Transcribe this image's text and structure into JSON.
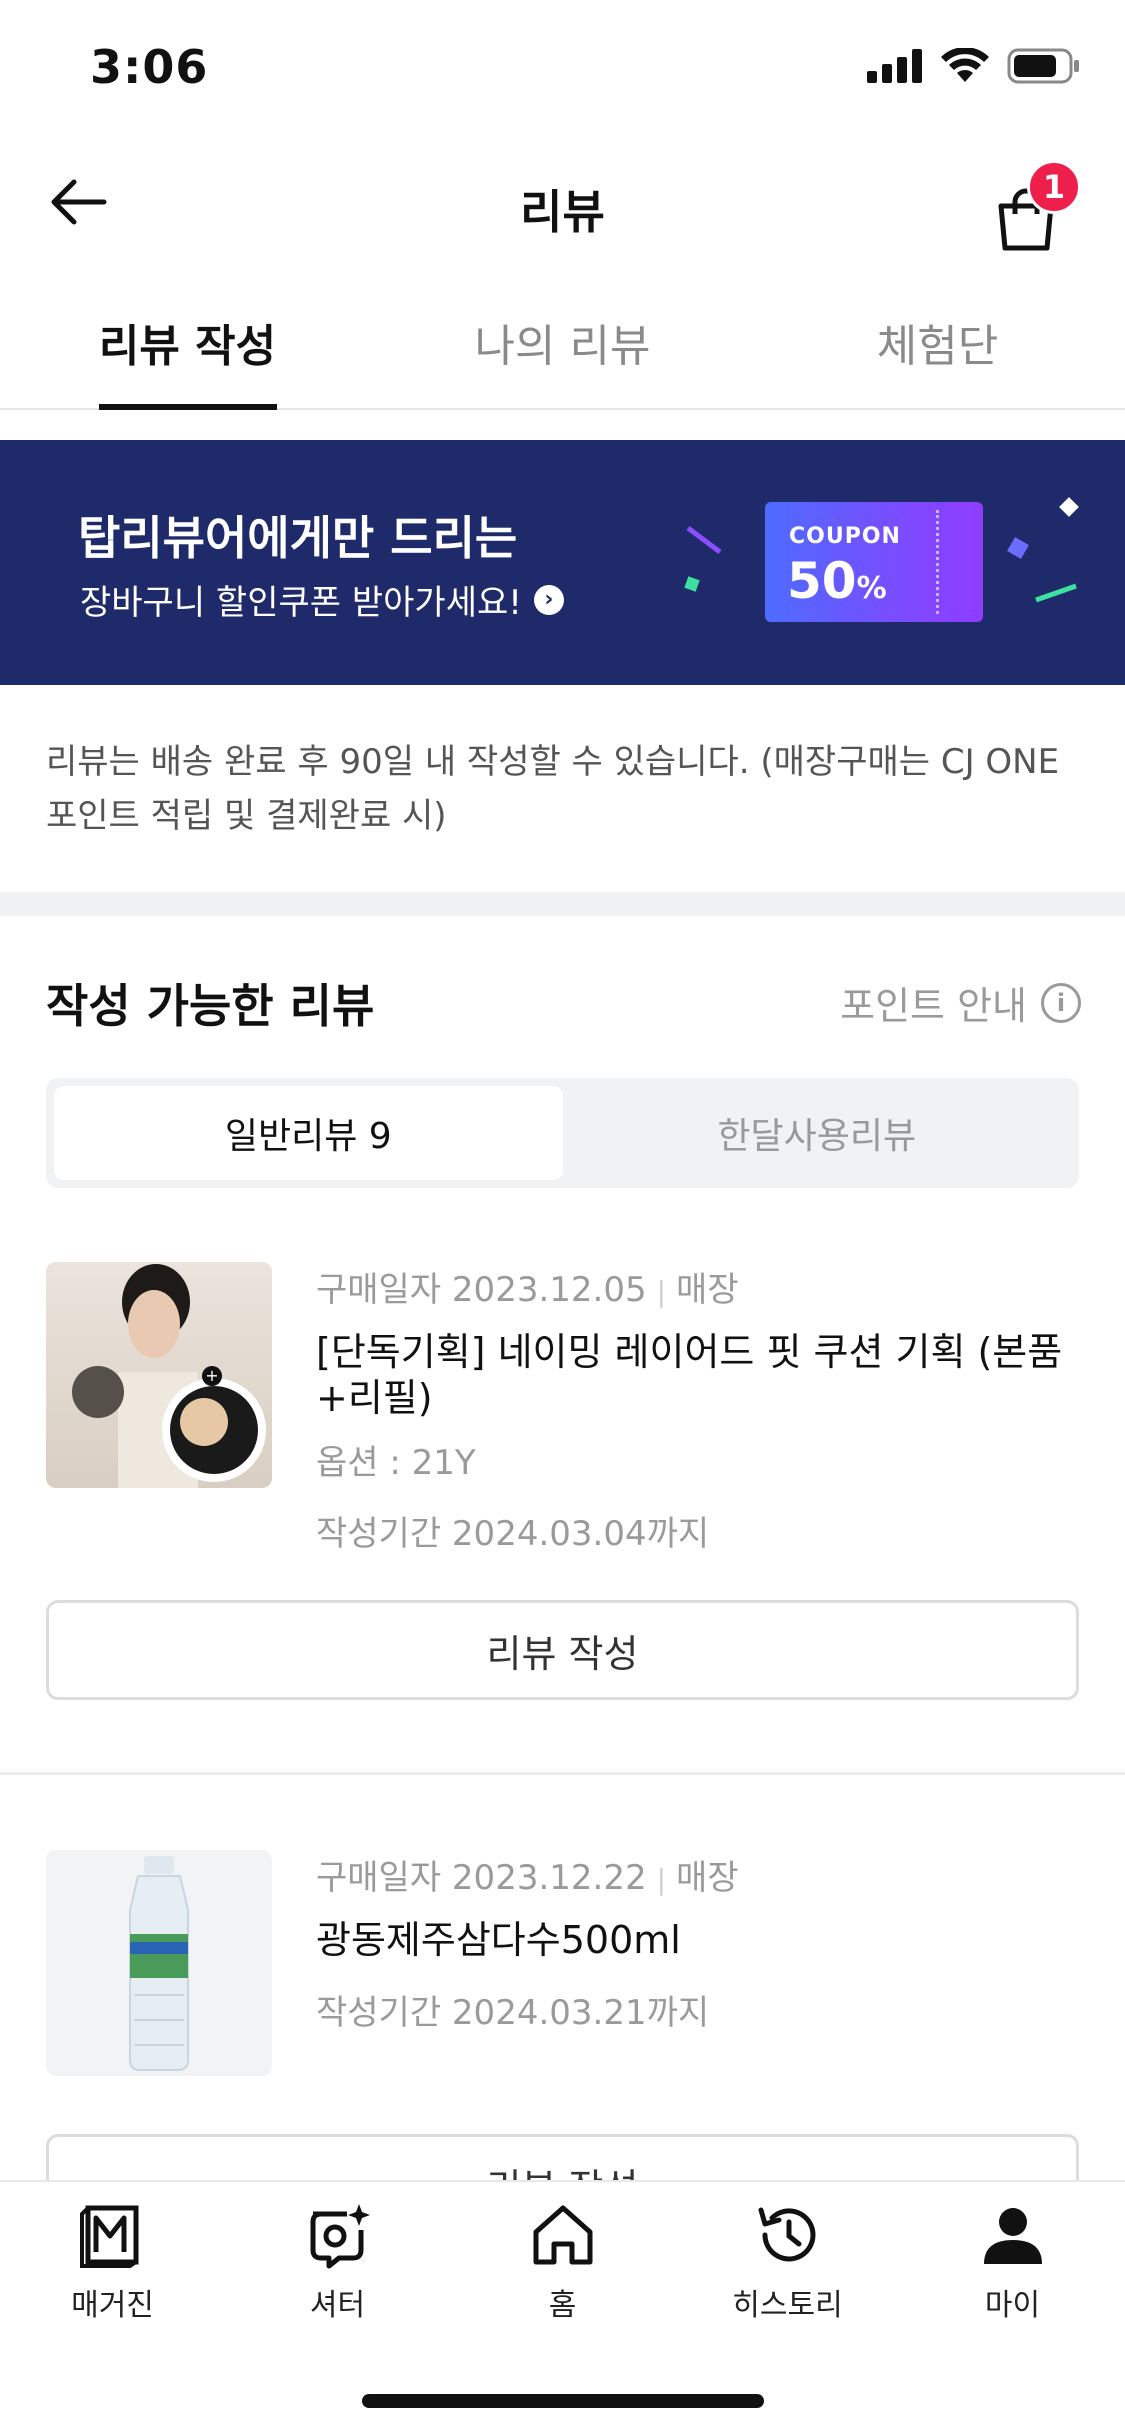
{
  "status_bar": {
    "time": "3:06"
  },
  "header": {
    "title": "리뷰",
    "cart_count": "1"
  },
  "tabs": [
    {
      "label": "리뷰 작성",
      "active": true
    },
    {
      "label": "나의 리뷰",
      "active": false
    },
    {
      "label": "체험단",
      "active": false
    }
  ],
  "banner": {
    "line1": "탑리뷰어에게만 드리는",
    "line2": "장바구니 할인쿠폰 받아가세요!",
    "coupon_label": "COUPON",
    "coupon_value": "50",
    "coupon_unit": "%"
  },
  "notice": "리뷰는 배송 완료 후 90일 내 작성할 수 있습니다. (매장구매는 CJ ONE 포인트 적립 및 결제완료 시)",
  "section": {
    "title": "작성 가능한 리뷰",
    "point_guide": "포인트 안내"
  },
  "segments": [
    {
      "label": "일반리뷰 9",
      "active": true
    },
    {
      "label": "한달사용리뷰",
      "active": false
    }
  ],
  "items": [
    {
      "purchase_date": "구매일자 2023.12.05",
      "channel": "매장",
      "name": "[단독기획] 네이밍 레이어드 핏 쿠션 기획 (본품+리필)",
      "option": "옵션 : 21Y",
      "period": "작성기간 2024.03.04까지",
      "button": "리뷰 작성"
    },
    {
      "purchase_date": "구매일자 2023.12.22",
      "channel": "매장",
      "name": "광동제주삼다수500ml",
      "option": "",
      "period": "작성기간 2024.03.21까지",
      "button": "리뷰 작성"
    }
  ],
  "bottom_nav": [
    {
      "label": "매거진",
      "icon": "magazine-icon"
    },
    {
      "label": "셔터",
      "icon": "shutter-icon"
    },
    {
      "label": "홈",
      "icon": "home-icon"
    },
    {
      "label": "히스토리",
      "icon": "history-icon"
    },
    {
      "label": "마이",
      "icon": "person-icon"
    }
  ],
  "colors": {
    "banner_bg": "#1f2a6b",
    "badge": "#ef1f4b",
    "coupon_start": "#4d6cff",
    "coupon_end": "#8e3dff"
  }
}
